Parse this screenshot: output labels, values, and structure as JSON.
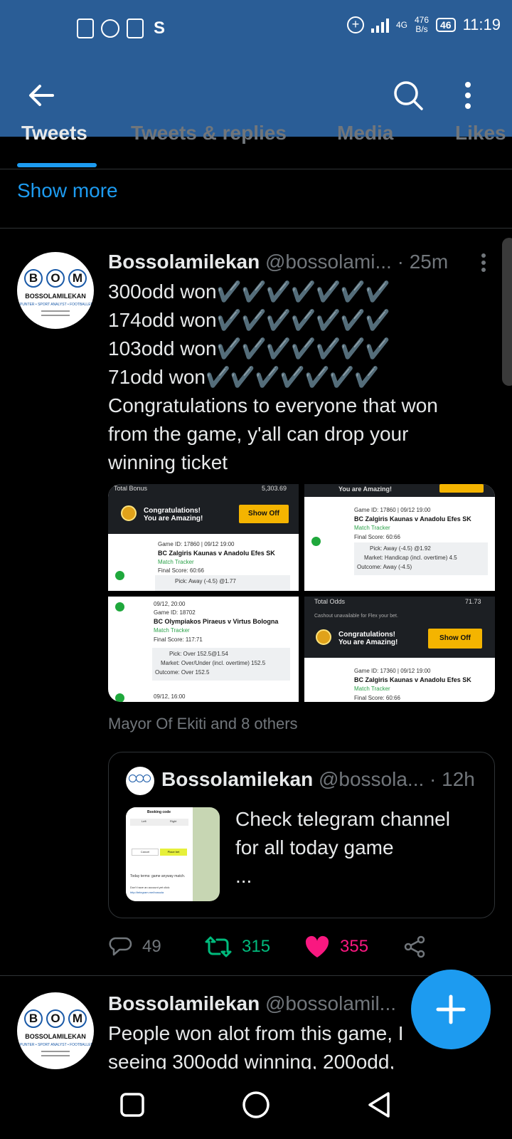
{
  "status_bar": {
    "net_type": "4G",
    "net_speed_value": "476",
    "net_speed_unit": "B/s",
    "battery": "46",
    "time": "11:19"
  },
  "colors": {
    "header_bg": "#2a5d96",
    "accent": "#1d9bf0",
    "retweet": "#00ba7c",
    "like": "#f91880"
  },
  "tabs": [
    {
      "label": "Tweets"
    },
    {
      "label": "Tweets & replies"
    },
    {
      "label": "Media"
    },
    {
      "label": "Likes"
    }
  ],
  "show_more": "Show more",
  "avatar": {
    "letters": [
      "B",
      "O",
      "M"
    ],
    "brand_name": "BOSSOLAMILEKAN",
    "tagline": "• PUNTER • SPORT ANALYST • FOOTBALLER"
  },
  "tweet": {
    "name": "Bossolamilekan",
    "handle": "@bossolami...",
    "time": "· 25m",
    "lines": [
      "300odd won✔️✔️✔️✔️✔️✔️✔️",
      "174odd won✔️✔️✔️✔️✔️✔️✔️",
      "103odd won✔️✔️✔️✔️✔️✔️✔️",
      "71odd won✔️✔️✔️✔️✔️✔️✔️",
      "Congratulations to everyone that won",
      "from the game, y'all can drop your",
      "winning ticket"
    ],
    "liked_by": "Mayor Of Ekiti and 8 others",
    "replies": "49",
    "retweets": "315",
    "likes": "355"
  },
  "media": {
    "img1": {
      "total_label": "Total Bonus",
      "total_value": "5,303.69",
      "congrats_1": "Congratulations!",
      "congrats_2": "You are Amazing!",
      "show_off": "Show Off",
      "game_id": "Game ID: 17860 | 09/12 19:00",
      "match": "BC Zalgiris Kaunas v Anadolu Efes SK",
      "tracker": "Match Tracker",
      "final": "Final Score: 60:66",
      "pick": "Pick: Away (-4.5) @1.77"
    },
    "img2": {
      "top": "You are Amazing!",
      "game_id": "Game ID: 17860 | 09/12 19:00",
      "match": "BC Zalgiris Kaunas v Anadolu Efes SK",
      "tracker": "Match Tracker",
      "final": "Final Score: 60:66",
      "pick": "Pick: Away (-4.5) @1.92",
      "market": "Market: Handicap (incl. overtime) 4.5",
      "outcome": "Outcome: Away (-4.5)"
    },
    "img3": {
      "date": "09/12, 20:00",
      "game_id": "Game ID: 18702",
      "match": "BC Olympiakos Piraeus v Virtus Bologna",
      "tracker": "Match Tracker",
      "final": "Final Score: 117:71",
      "pick": "Pick: Over 152.5@1.54",
      "market": "Market: Over/Under (incl. overtime) 152.5",
      "outcome": "Outcome: Over 152.5",
      "footer": "09/12, 16:00"
    },
    "img4": {
      "total_label": "Total Odds",
      "total_value": "71.73",
      "note": "Cashout unavailable for Flex your bet.",
      "congrats_1": "Congratulations!",
      "congrats_2": "You are Amazing!",
      "show_off": "Show Off",
      "game_id": "Game ID: 17360 | 09/12 19:00",
      "match": "BC Zalgiris Kaunas v Anadolu Efes SK",
      "tracker": "Match Tracker",
      "final": "Final Score: 60:66"
    }
  },
  "quote": {
    "name": "Bossolamilekan",
    "handle": "@bossola...",
    "time": "· 12h",
    "text_lines": [
      "Check telegram channel",
      "for all today game",
      "..."
    ],
    "thumb": {
      "title": "Booking code",
      "tab1": "Left",
      "tab2": "Right",
      "btn1": "Cancel",
      "btn2": "Place bet",
      "caption": "Today terms: game anyway match.",
      "footer": "Don't have an account yet click:",
      "link": "http://telegram.me/bossola"
    }
  },
  "tweet2": {
    "name": "Bossolamilekan",
    "handle": "@bossolamil...",
    "lines": [
      "People won alot from this game, I",
      "seeing 300odd winning, 200odd,"
    ]
  }
}
